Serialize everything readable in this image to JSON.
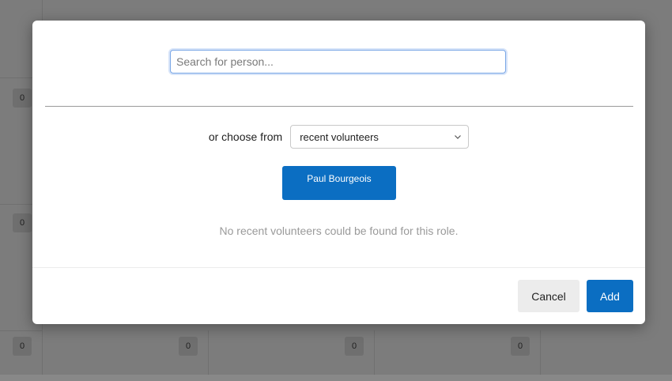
{
  "background": {
    "badges": [
      "0",
      "0",
      "0",
      "0",
      "0",
      "0",
      "0"
    ]
  },
  "modal": {
    "search": {
      "placeholder": "Search for person...",
      "value": ""
    },
    "choose": {
      "label": "or choose from",
      "selected": "recent volunteers"
    },
    "person_button": "Paul Bourgeois",
    "empty_message": "No recent volunteers could be found for this role.",
    "buttons": {
      "cancel": "Cancel",
      "add": "Add"
    }
  },
  "colors": {
    "primary": "#0b6ec2",
    "overlay": "#7c7c7c"
  }
}
